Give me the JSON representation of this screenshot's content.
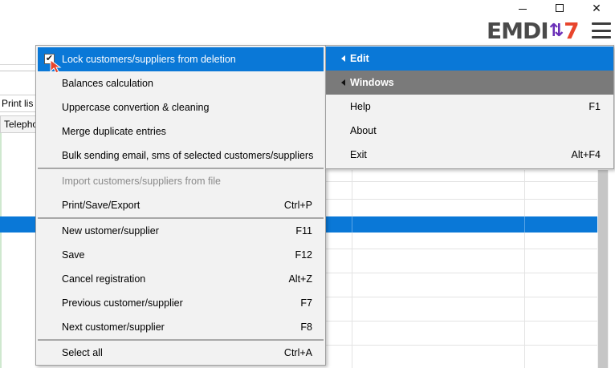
{
  "background": {
    "toolbar_fragment": "Print lis",
    "header_fragment": "Telepho"
  },
  "logo": {
    "part1": "EMDI",
    "arrows": "⇅",
    "part2": "7"
  },
  "window_controls": {
    "minimize": "minimize-icon",
    "maximize": "maximize-icon",
    "close_glyph": "✕"
  },
  "main_menu": {
    "items": [
      {
        "label": "Lock customers/suppliers from deletion",
        "shortcut": "",
        "checked": true,
        "highlighted": true
      },
      {
        "label": "Balances calculation",
        "shortcut": ""
      },
      {
        "label": "Uppercase convertion & cleaning",
        "shortcut": ""
      },
      {
        "label": "Merge duplicate entries",
        "shortcut": ""
      },
      {
        "label": "Bulk sending email, sms of selected customers/suppliers",
        "shortcut": ""
      },
      {
        "label": "Import customers/suppliers from file",
        "shortcut": "",
        "disabled": true
      },
      {
        "label": "Print/Save/Export",
        "shortcut": "Ctrl+P"
      },
      {
        "label": "New ustomer/supplier",
        "shortcut": "F11"
      },
      {
        "label": "Save",
        "shortcut": "F12"
      },
      {
        "label": "Cancel registration",
        "shortcut": "Alt+Z"
      },
      {
        "label": "Previous customer/supplier",
        "shortcut": "F7"
      },
      {
        "label": "Next customer/supplier",
        "shortcut": "F8"
      },
      {
        "label": "Select all",
        "shortcut": "Ctrl+A"
      }
    ],
    "check_glyph": "✔"
  },
  "side_menu": {
    "items": [
      {
        "label": "Edit",
        "shortcut": "",
        "submenu": true
      },
      {
        "label": "Windows",
        "shortcut": "",
        "submenu": true
      },
      {
        "label": "Help",
        "shortcut": "F1"
      },
      {
        "label": "About",
        "shortcut": ""
      },
      {
        "label": "Exit",
        "shortcut": "Alt+F4"
      }
    ]
  },
  "colors": {
    "highlight_blue": "#0a78d7",
    "submenu_gray": "#7a7a7a",
    "menu_bg": "#f2f2f2",
    "logo_red": "#e8452c",
    "logo_purple": "#6a2fb8"
  }
}
